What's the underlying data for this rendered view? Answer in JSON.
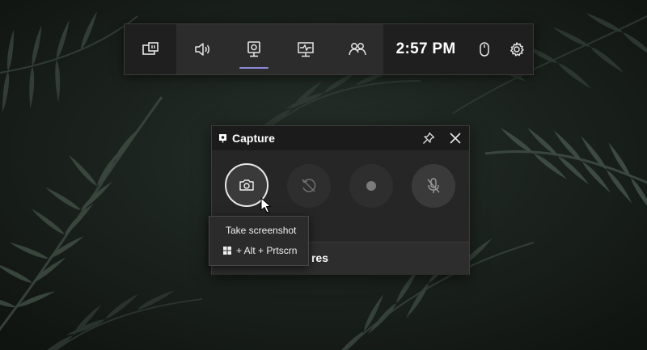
{
  "gamebar": {
    "widgets": [
      {
        "name": "widget-menu",
        "icon": "widget-menu-icon"
      },
      {
        "name": "audio",
        "icon": "speaker-icon"
      },
      {
        "name": "capture",
        "icon": "capture-icon",
        "active": true
      },
      {
        "name": "performance",
        "icon": "performance-monitor-icon"
      },
      {
        "name": "xbox-social",
        "icon": "people-icon"
      }
    ],
    "time": "2:57 PM",
    "mouse_icon": "mouse-icon",
    "settings_icon": "gear-icon",
    "accent_color": "#8b8ad9"
  },
  "capture": {
    "title": "Capture",
    "buttons": [
      {
        "name": "take-screenshot",
        "icon": "camera-icon"
      },
      {
        "name": "record-last-30s",
        "icon": "rewind-disabled-icon"
      },
      {
        "name": "start-recording",
        "icon": "record-dot-icon"
      },
      {
        "name": "mic-toggle",
        "icon": "mic-off-icon"
      }
    ],
    "footer_text": "res"
  },
  "tooltip": {
    "title": "Take screenshot",
    "shortcut": "+ Alt + Prtscrn",
    "shortcut_icon": "windows-logo-icon"
  }
}
